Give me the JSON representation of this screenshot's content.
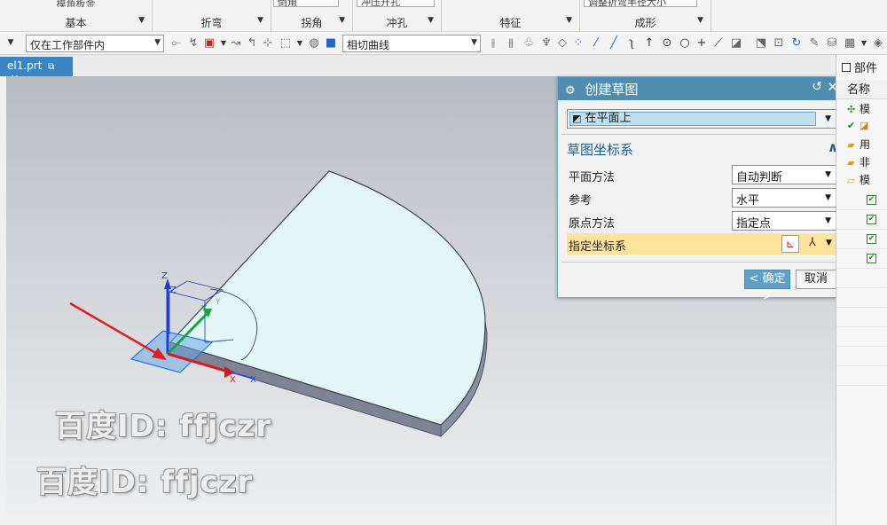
{
  "ribbon": {
    "groups": [
      {
        "label": "基本",
        "cut": "模角板金"
      },
      {
        "label": "折弯",
        "cut": ""
      },
      {
        "label": "拐角",
        "cut": "倒角"
      },
      {
        "label": "冲孔",
        "cut": "冲压开孔"
      },
      {
        "label": "特征",
        "cut": ""
      },
      {
        "label": "成形",
        "cut": "调整折弯半径大小"
      }
    ]
  },
  "toolbar": {
    "filter": "仅在工作部件内",
    "curve_rule": "相切曲线"
  },
  "file_tab": {
    "label": "el1.prt"
  },
  "viewport": {
    "triad": {
      "z": "Z",
      "y": "Y",
      "x": "X"
    },
    "watermark": "百度ID: ffjczr",
    "colors": {
      "face": "#e3f5f7",
      "edge": "#5a5f6b",
      "side": "#7e8494",
      "arrow": "#e02020"
    }
  },
  "dialog": {
    "title": "创建草图",
    "type_value": "在平面上",
    "section_title": "草图坐标系",
    "rows": [
      {
        "label": "平面方法",
        "value": "自动判断"
      },
      {
        "label": "参考",
        "value": "水平"
      },
      {
        "label": "原点方法",
        "value": "指定点"
      }
    ],
    "csys_label": "指定坐标系",
    "ok": "< 确定 >",
    "cancel": "取消"
  },
  "navigator": {
    "title": "部件",
    "column": "名称",
    "items": [
      "模",
      "",
      "用",
      "非",
      "模"
    ]
  }
}
